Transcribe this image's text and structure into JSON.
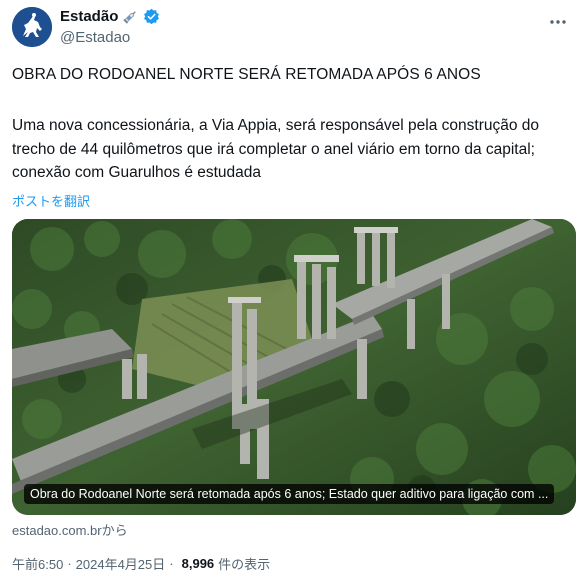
{
  "author": {
    "display_name": "Estadão",
    "handle": "@Estadao",
    "avatar_icon": "horse-rider-logo-icon",
    "badge_icon": "syringe-icon",
    "verified_icon": "verified-badge-icon",
    "verified_color": "#1d9bf0"
  },
  "tweet": {
    "headline": "OBRA DO RODOANEL NORTE SERÁ RETOMADA APÓS 6 ANOS",
    "body": "Uma nova concessionária, a Via Appia, será responsável pela construção do trecho de 44 quilômetros que irá completar o anel viário em torno da capital; conexão com Guarulhos é estudada",
    "translate_label": "ポストを翻訳"
  },
  "card": {
    "caption": "Obra do Rodoanel Norte será retomada após 6 anos; Estado quer aditivo para ligação com ...",
    "domain": "estadao.com.brから"
  },
  "meta": {
    "time": "午前6:50",
    "date": "2024年4月25日",
    "separator": "·",
    "views_count": "8,996",
    "views_label": "件の表示"
  },
  "colors": {
    "link": "#1d9bf0",
    "secondary_text": "#536471",
    "primary_text": "#0f1419",
    "avatar_bg": "#1d4f91"
  }
}
